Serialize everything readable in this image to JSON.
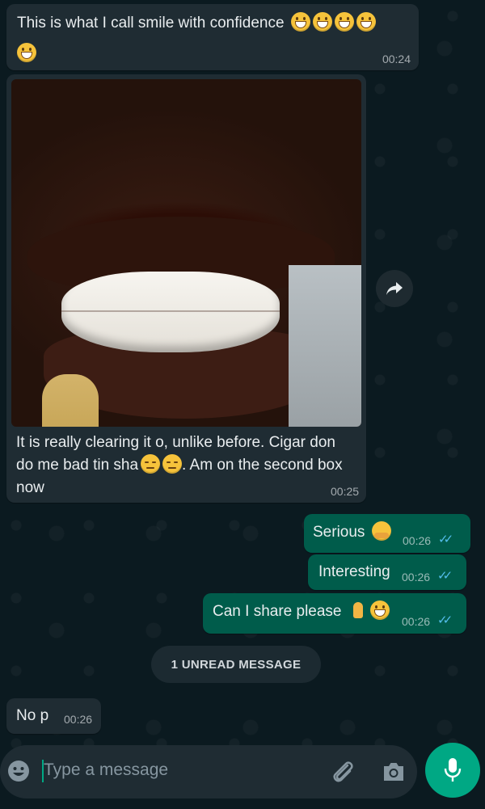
{
  "colors": {
    "incoming_bubble": "#1f2c33",
    "outgoing_bubble": "#005c4b",
    "read_ticks": "#53bdeb",
    "accent": "#00a884"
  },
  "messages": [
    {
      "direction": "in",
      "text": "This is what I call smile with confidence",
      "emojis": [
        "grinning-face",
        "grinning-face",
        "grinning-face",
        "grinning-face",
        "grinning-face"
      ],
      "time": "00:24"
    },
    {
      "direction": "in",
      "type": "image",
      "caption_line1": "It is really clearing it o, unlike before. Cigar don",
      "caption_line2_a": "do me bad tin sha",
      "caption_line2_b": ". Am on the second box",
      "caption_line3": "now",
      "emojis": [
        "pensive-face",
        "pensive-face"
      ],
      "time": "00:25"
    },
    {
      "direction": "out",
      "text": "Serious",
      "emojis": [
        "hugging-face"
      ],
      "time": "00:26",
      "status": "read"
    },
    {
      "direction": "out",
      "text": "Interesting",
      "time": "00:26",
      "status": "read"
    },
    {
      "direction": "out",
      "text": "Can I share please",
      "emojis": [
        "folded-hands",
        "grinning-face"
      ],
      "time": "00:26",
      "status": "read"
    },
    {
      "direction": "in",
      "text": "No p",
      "time": "00:26"
    }
  ],
  "unread_divider": "1 UNREAD MESSAGE",
  "composer": {
    "placeholder": "Type a message",
    "icons": [
      "emoji-icon",
      "attach-icon",
      "camera-icon",
      "mic-icon"
    ]
  },
  "image_forward_icon": "forward-icon"
}
